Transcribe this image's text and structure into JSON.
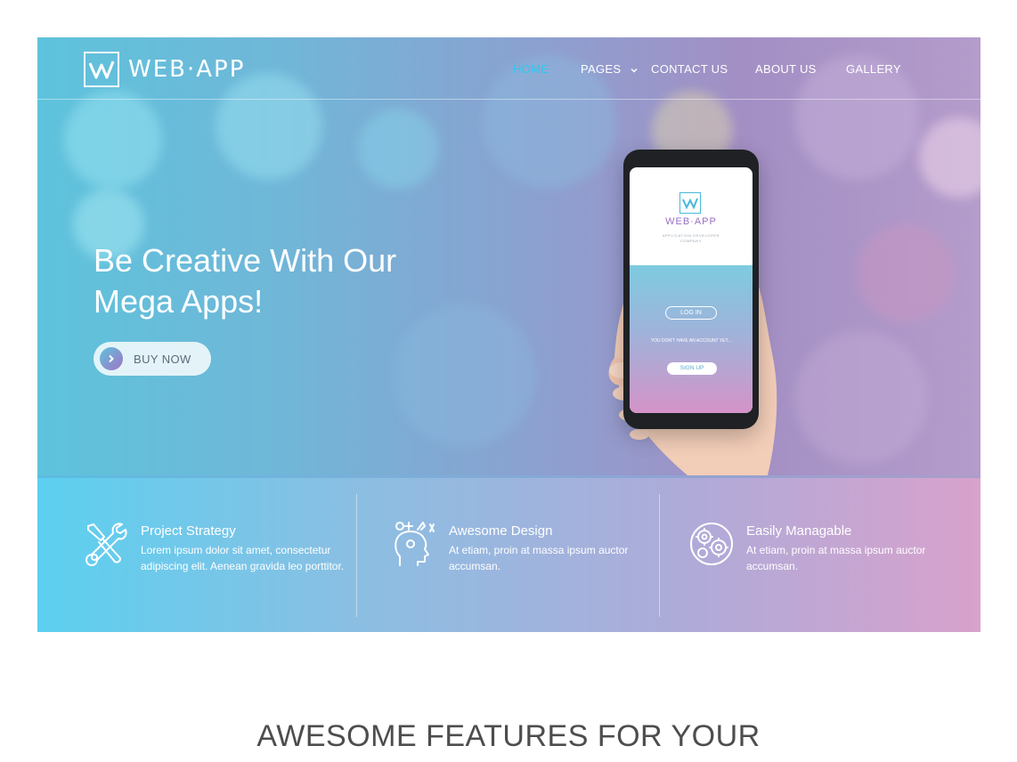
{
  "brand": {
    "name": "WEB·APP"
  },
  "nav": {
    "items": [
      {
        "label": "HOME",
        "active": true
      },
      {
        "label": "PAGES",
        "has_dropdown": true
      },
      {
        "label": "CONTACT US"
      },
      {
        "label": "ABOUT US"
      },
      {
        "label": "GALLERY"
      }
    ]
  },
  "hero": {
    "title_line1": "Be Creative With Our",
    "title_line2": "Mega Apps!",
    "cta_label": "BUY NOW"
  },
  "phone_screen": {
    "brand": "WEB·APP",
    "tagline_line1": "APPLICATION DEVELOPER",
    "tagline_line2": "COMPANY",
    "login_label": "LOG IN",
    "note": "YOU DON'T HAVE AN ACCOUNT YET...",
    "signup_label": "SIGN UP"
  },
  "features": [
    {
      "icon": "wrench-screwdriver-icon",
      "title": "Project Strategy",
      "text": "Lorem ipsum dolor sit amet, consectetur adipiscing elit. Aenean gravida leo porttitor."
    },
    {
      "icon": "creative-head-icon",
      "title": "Awesome Design",
      "text": "At etiam, proin at massa ipsum auctor accumsan."
    },
    {
      "icon": "gears-globe-icon",
      "title": "Easily Managable",
      "text": "At etiam, proin at massa ipsum auctor accumsan."
    }
  ],
  "section": {
    "heading": "AWESOME FEATURES FOR YOUR"
  },
  "colors": {
    "nav_active": "#2ec8f0",
    "gradient_start": "#5cd0f0",
    "gradient_end": "#d8a2cc"
  }
}
